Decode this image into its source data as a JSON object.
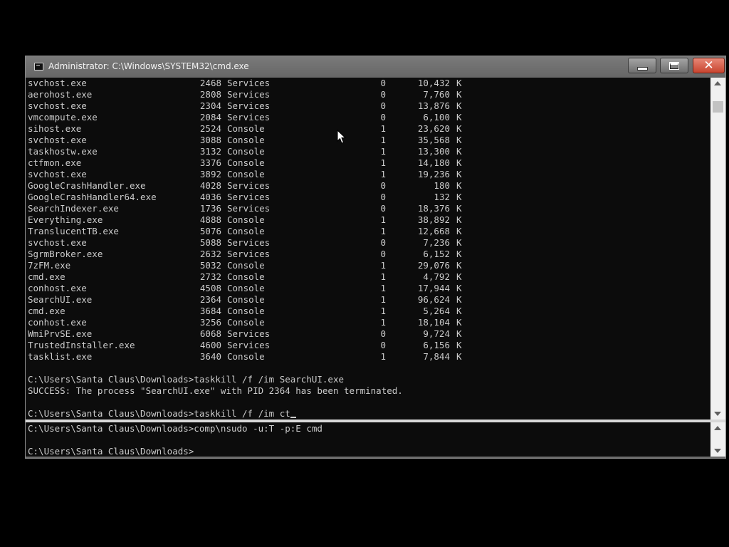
{
  "window": {
    "title": "Administrator: C:\\Windows\\SYSTEM32\\cmd.exe",
    "minimize_label": "minimize",
    "maximize_label": "maximize",
    "close_label": "close"
  },
  "processes": [
    {
      "name": "svchost.exe",
      "pid": "2468",
      "session": "Services",
      "num": "0",
      "mem": "10,432",
      "unit": "K"
    },
    {
      "name": "aerohost.exe",
      "pid": "2808",
      "session": "Services",
      "num": "0",
      "mem": "7,760",
      "unit": "K"
    },
    {
      "name": "svchost.exe",
      "pid": "2304",
      "session": "Services",
      "num": "0",
      "mem": "13,876",
      "unit": "K"
    },
    {
      "name": "vmcompute.exe",
      "pid": "2084",
      "session": "Services",
      "num": "0",
      "mem": "6,100",
      "unit": "K"
    },
    {
      "name": "sihost.exe",
      "pid": "2524",
      "session": "Console",
      "num": "1",
      "mem": "23,620",
      "unit": "K"
    },
    {
      "name": "svchost.exe",
      "pid": "3088",
      "session": "Console",
      "num": "1",
      "mem": "35,568",
      "unit": "K"
    },
    {
      "name": "taskhostw.exe",
      "pid": "3132",
      "session": "Console",
      "num": "1",
      "mem": "13,300",
      "unit": "K"
    },
    {
      "name": "ctfmon.exe",
      "pid": "3376",
      "session": "Console",
      "num": "1",
      "mem": "14,180",
      "unit": "K"
    },
    {
      "name": "svchost.exe",
      "pid": "3892",
      "session": "Console",
      "num": "1",
      "mem": "19,236",
      "unit": "K"
    },
    {
      "name": "GoogleCrashHandler.exe",
      "pid": "4028",
      "session": "Services",
      "num": "0",
      "mem": "180",
      "unit": "K"
    },
    {
      "name": "GoogleCrashHandler64.exe",
      "pid": "4036",
      "session": "Services",
      "num": "0",
      "mem": "132",
      "unit": "K"
    },
    {
      "name": "SearchIndexer.exe",
      "pid": "1736",
      "session": "Services",
      "num": "0",
      "mem": "18,376",
      "unit": "K"
    },
    {
      "name": "Everything.exe",
      "pid": "4888",
      "session": "Console",
      "num": "1",
      "mem": "38,892",
      "unit": "K"
    },
    {
      "name": "TranslucentTB.exe",
      "pid": "5076",
      "session": "Console",
      "num": "1",
      "mem": "12,668",
      "unit": "K"
    },
    {
      "name": "svchost.exe",
      "pid": "5088",
      "session": "Services",
      "num": "0",
      "mem": "7,236",
      "unit": "K"
    },
    {
      "name": "SgrmBroker.exe",
      "pid": "2632",
      "session": "Services",
      "num": "0",
      "mem": "6,152",
      "unit": "K"
    },
    {
      "name": "7zFM.exe",
      "pid": "5032",
      "session": "Console",
      "num": "1",
      "mem": "29,076",
      "unit": "K"
    },
    {
      "name": "cmd.exe",
      "pid": "2732",
      "session": "Console",
      "num": "1",
      "mem": "4,792",
      "unit": "K"
    },
    {
      "name": "conhost.exe",
      "pid": "4508",
      "session": "Console",
      "num": "1",
      "mem": "17,944",
      "unit": "K"
    },
    {
      "name": "SearchUI.exe",
      "pid": "2364",
      "session": "Console",
      "num": "1",
      "mem": "96,624",
      "unit": "K"
    },
    {
      "name": "cmd.exe",
      "pid": "3684",
      "session": "Console",
      "num": "1",
      "mem": "5,264",
      "unit": "K"
    },
    {
      "name": "conhost.exe",
      "pid": "3256",
      "session": "Console",
      "num": "1",
      "mem": "18,104",
      "unit": "K"
    },
    {
      "name": "WmiPrvSE.exe",
      "pid": "6068",
      "session": "Services",
      "num": "0",
      "mem": "9,724",
      "unit": "K"
    },
    {
      "name": "TrustedInstaller.exe",
      "pid": "4600",
      "session": "Services",
      "num": "0",
      "mem": "6,156",
      "unit": "K"
    },
    {
      "name": "tasklist.exe",
      "pid": "3640",
      "session": "Console",
      "num": "1",
      "mem": "7,844",
      "unit": "K"
    }
  ],
  "console": {
    "command_1": "C:\\Users\\Santa Claus\\Downloads>taskkill /f /im SearchUI.exe",
    "output_1": "SUCCESS: The process \"SearchUI.exe\" with PID 2364 has been terminated.",
    "current_input": "C:\\Users\\Santa Claus\\Downloads>taskkill /f /im ct"
  },
  "lower_console": {
    "command": "C:\\Users\\Santa Claus\\Downloads>comp\\nsudo -u:T -p:E cmd",
    "prompt": "C:\\Users\\Santa Claus\\Downloads>"
  }
}
